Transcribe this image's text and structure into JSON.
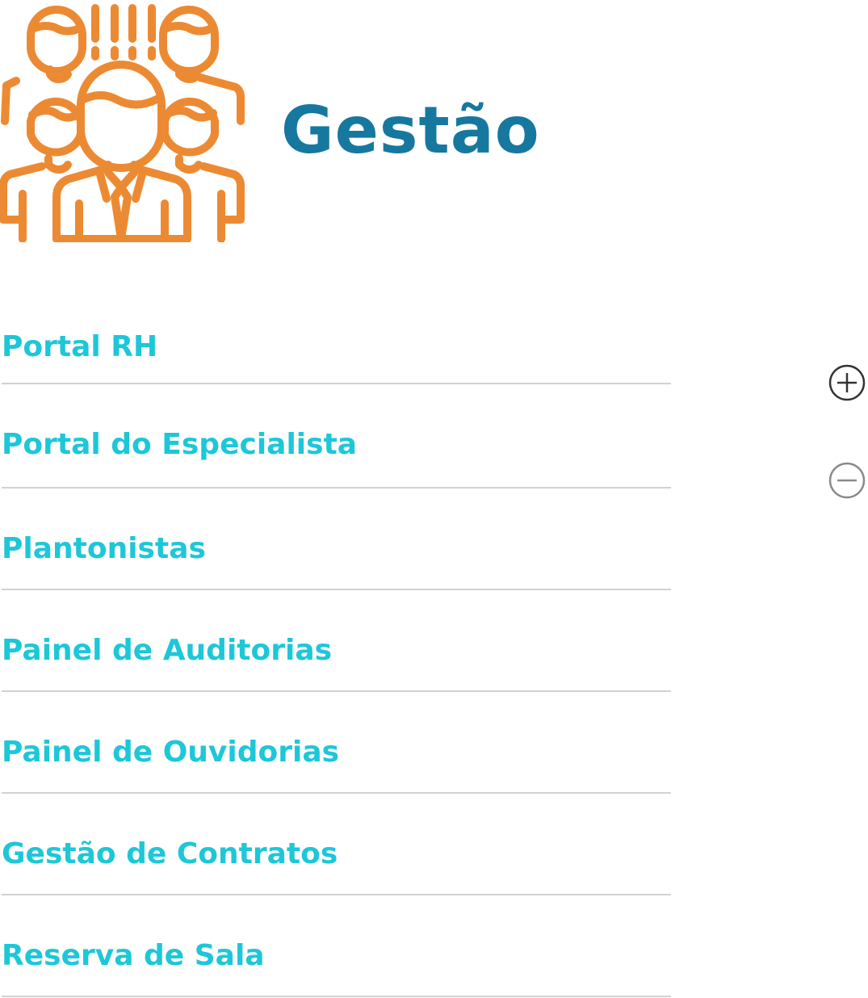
{
  "header": {
    "logo_icon": "people-group-icon",
    "logo_color": "#ec8a33",
    "title": "Gestão",
    "title_color": "#17789f"
  },
  "menu": {
    "item_color": "#1dc7d8",
    "divider_color": "#d2d2d2",
    "items": [
      {
        "label": "Portal RH"
      },
      {
        "label": "Portal do Especialista"
      },
      {
        "label": "Plantonistas"
      },
      {
        "label": "Painel de Auditorias"
      },
      {
        "label": "Painel de Ouvidorias"
      },
      {
        "label": "Gestão de Contratos"
      },
      {
        "label": "Reserva de Sala"
      }
    ]
  },
  "controls": {
    "expand_icon": "plus-circle-icon",
    "collapse_icon": "minus-circle-icon"
  }
}
